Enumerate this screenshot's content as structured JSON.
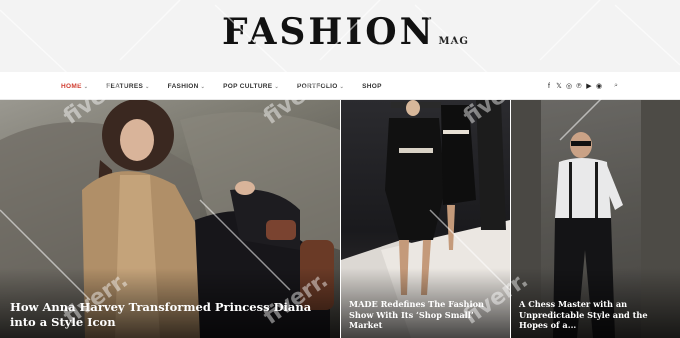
{
  "brand": {
    "name": "FASHION",
    "sub": "MAG"
  },
  "nav": {
    "items": [
      {
        "label": "HOME",
        "has_caret": true,
        "active": true
      },
      {
        "label": "FEATURES",
        "has_caret": true,
        "active": false
      },
      {
        "label": "FASHION",
        "has_caret": true,
        "active": false
      },
      {
        "label": "POP CULTURE",
        "has_caret": true,
        "active": false
      },
      {
        "label": "PORTFOLIO",
        "has_caret": true,
        "active": false
      },
      {
        "label": "SHOP",
        "has_caret": false,
        "active": false
      }
    ],
    "caret": "⌄"
  },
  "social": {
    "icons": [
      {
        "name": "facebook-icon",
        "glyph": "f"
      },
      {
        "name": "x-icon",
        "glyph": "𝕏"
      },
      {
        "name": "instagram-icon",
        "glyph": "◎"
      },
      {
        "name": "pinterest-icon",
        "glyph": "℗"
      },
      {
        "name": "youtube-icon",
        "glyph": "▶"
      },
      {
        "name": "spotify-icon",
        "glyph": "◉"
      }
    ],
    "search_icon": "⌕"
  },
  "posts": [
    {
      "title": "How Anna Harvey Transformed Princess Diana into a Style Icon"
    },
    {
      "title": "MADE Redefines The Fashion Show With Its ‘Shop Small’ Market"
    },
    {
      "title": "A Chess Master with an Unpredictable Style and the Hopes of a..."
    }
  ],
  "colors": {
    "accent": "#d03c2f",
    "masthead_bg": "#f3f3f3"
  }
}
